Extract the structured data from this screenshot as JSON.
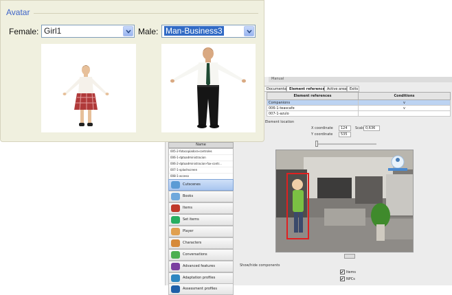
{
  "avatar": {
    "section_title": "Avatar",
    "female_label": "Female:",
    "female_value": "Girl1",
    "male_label": "Male:",
    "male_value": "Man-Business3"
  },
  "editor": {
    "title": "Manual",
    "tabs": [
      "Documentation",
      "Element references",
      "Active areas",
      "Exits"
    ],
    "table_headers": [
      "Element references",
      "Conditions"
    ],
    "table_rows": [
      {
        "element": "Companions",
        "condition": "v"
      },
      {
        "element": "006-1-teascafe",
        "condition": "v"
      },
      {
        "element": "007-1-azulo",
        "condition": ""
      }
    ],
    "element_location_label": "Element location",
    "x_coordinate_label": "X coordinate",
    "x_value": "124",
    "y_coordinate_label": "Y coordinate",
    "y_value": "535",
    "scale_label": "Scale",
    "scale_value": "0,636",
    "show_hide_label": "Show/hide components",
    "checkbox_items": [
      "Items",
      "NPCs"
    ]
  },
  "nav": {
    "name_header": "Name",
    "names": [
      "005-2-fotocopiadora-controles",
      "006-1-dptoadministracion",
      "006-2-dptoadministracion-fax-contr...",
      "007-1-splashscreen",
      "008-1-acceso"
    ],
    "items": [
      {
        "label": "Cutscenes",
        "icon": "cutscenes-icon",
        "color": "#5b9bd5"
      },
      {
        "label": "Books",
        "icon": "book-icon",
        "color": "#6fa8dc"
      },
      {
        "label": "Items",
        "icon": "items-icon",
        "color": "#c0392b"
      },
      {
        "label": "Set items",
        "icon": "set-items-icon",
        "color": "#27ae60"
      },
      {
        "label": "Player",
        "icon": "player-icon",
        "color": "#e0a050"
      },
      {
        "label": "Characters",
        "icon": "characters-icon",
        "color": "#d68a3a"
      },
      {
        "label": "Conversations",
        "icon": "conversations-icon",
        "color": "#4caf50"
      },
      {
        "label": "Advanced features",
        "icon": "advanced-features-icon",
        "color": "#7b3fa0"
      },
      {
        "label": "Adaptation profiles",
        "icon": "adaptation-profiles-icon",
        "color": "#2e86c1"
      },
      {
        "label": "Assessment profiles",
        "icon": "assessment-profiles-icon",
        "color": "#1f5fa8"
      }
    ]
  },
  "colors": {
    "panel_bg": "#f0f0df",
    "title_blue": "#3d63c8",
    "selection_blue": "#316ac5",
    "highlight_red": "#e02020"
  }
}
